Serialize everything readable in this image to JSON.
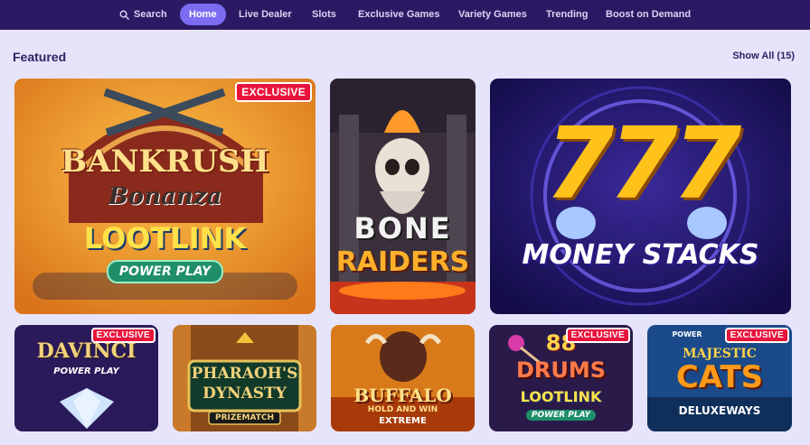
{
  "nav": {
    "search_label": "Search",
    "items": [
      "Home",
      "Live Dealer",
      "Slots",
      "Exclusive Games",
      "Variety Games",
      "Trending",
      "Boost on Demand"
    ],
    "active": "Home"
  },
  "featured": {
    "title": "Featured",
    "show_all": "Show All (15)"
  },
  "badges": {
    "exclusive": "EXCLUSIVE"
  },
  "games": {
    "bankrush": {
      "line1": "BANKRUSH",
      "line2": "Bonanza",
      "line3": "LOOT",
      "line3b": "LINK",
      "line4": "POWER PLAY"
    },
    "bone": {
      "line1": "BONE",
      "line2": "RAIDERS"
    },
    "money": {
      "digits": "777",
      "line1": "MONEY STACKS"
    },
    "davinci": {
      "line1": "DAVINCI",
      "line2": "POWER PLAY"
    },
    "pharaoh": {
      "line1": "PHARAOH'S",
      "line2": "DYNASTY",
      "line3": "PRIZEMATCH"
    },
    "buffalo": {
      "line1": "BUFFALO",
      "line2": "HOLD AND WIN",
      "line3": "EXTREME"
    },
    "drums": {
      "line1": "88",
      "line2": "DRUMS",
      "line3": "LOOT",
      "line3b": "LINK",
      "line4": "POWER PLAY"
    },
    "cats": {
      "line0": "POWER",
      "line1": "MAJESTIC",
      "line2": "CATS",
      "line3": "DELUXEWAYS"
    }
  },
  "colors": {
    "nav_bg": "#2b1a63",
    "page_bg": "#e6e4fb",
    "active_pill": "#7b6cf2",
    "badge_red": "#e8143c",
    "heading": "#2a2362"
  },
  "icons": {
    "search": "search-icon"
  }
}
